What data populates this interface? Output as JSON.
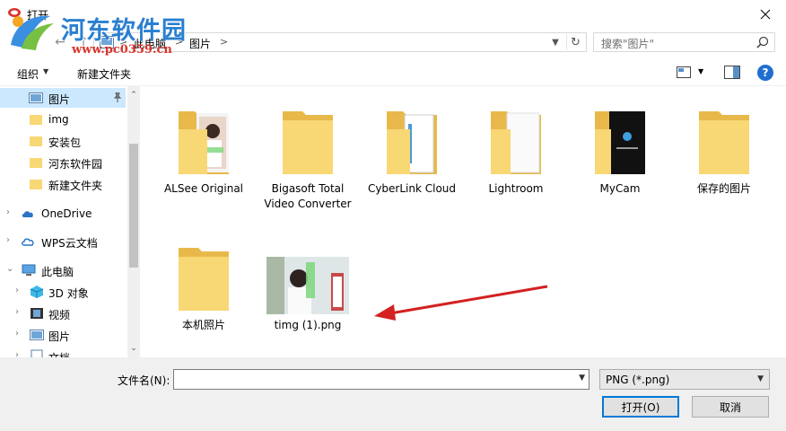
{
  "window": {
    "title": "打开",
    "close_label": "关闭"
  },
  "watermark": {
    "site_name": "河东软件园",
    "url": "www.pc0359.cn"
  },
  "address": {
    "crumbs": [
      "此电脑",
      "图片"
    ],
    "separator": ">",
    "refresh_icon": "refresh-icon"
  },
  "search": {
    "placeholder": "搜索\"图片\""
  },
  "toolbar": {
    "organize_label": "组织",
    "new_folder_label": "新建文件夹",
    "help_label": "?"
  },
  "nav": {
    "items": [
      {
        "label": "图片",
        "icon": "pictures-icon",
        "selected": true,
        "pinned": true
      },
      {
        "label": "img",
        "icon": "folder-icon"
      },
      {
        "label": "安装包",
        "icon": "folder-icon"
      },
      {
        "label": "河东软件园",
        "icon": "folder-icon"
      },
      {
        "label": "新建文件夹",
        "icon": "folder-icon"
      },
      {
        "label": "OneDrive",
        "icon": "cloud-icon"
      },
      {
        "label": "WPS云文档",
        "icon": "wps-cloud-icon"
      },
      {
        "label": "此电脑",
        "icon": "computer-icon"
      },
      {
        "label": "3D 对象",
        "icon": "3d-objects-icon"
      },
      {
        "label": "视频",
        "icon": "video-icon"
      },
      {
        "label": "图片",
        "icon": "pictures-icon"
      },
      {
        "label": "文档",
        "icon": "documents-icon"
      }
    ]
  },
  "files": [
    {
      "name": "ALSee Original",
      "type": "folder-photo"
    },
    {
      "name": "Bigasoft Total Video Converter",
      "type": "folder"
    },
    {
      "name": "CyberLink Cloud",
      "type": "folder-doc"
    },
    {
      "name": "Lightroom",
      "type": "folder-white"
    },
    {
      "name": "MyCam",
      "type": "folder-dark"
    },
    {
      "name": "保存的图片",
      "type": "folder"
    },
    {
      "name": "本机照片",
      "type": "folder"
    },
    {
      "name": "timg (1).png",
      "type": "image"
    }
  ],
  "bottom": {
    "filename_label": "文件名(N):",
    "filename_value": "",
    "filetype_value": "PNG (*.png)",
    "open_label": "打开(O)",
    "cancel_label": "取消"
  },
  "colors": {
    "accent": "#0078d7",
    "folder": "#f8d775",
    "arrow": "#d42121",
    "selected_bg": "#cce8ff"
  }
}
